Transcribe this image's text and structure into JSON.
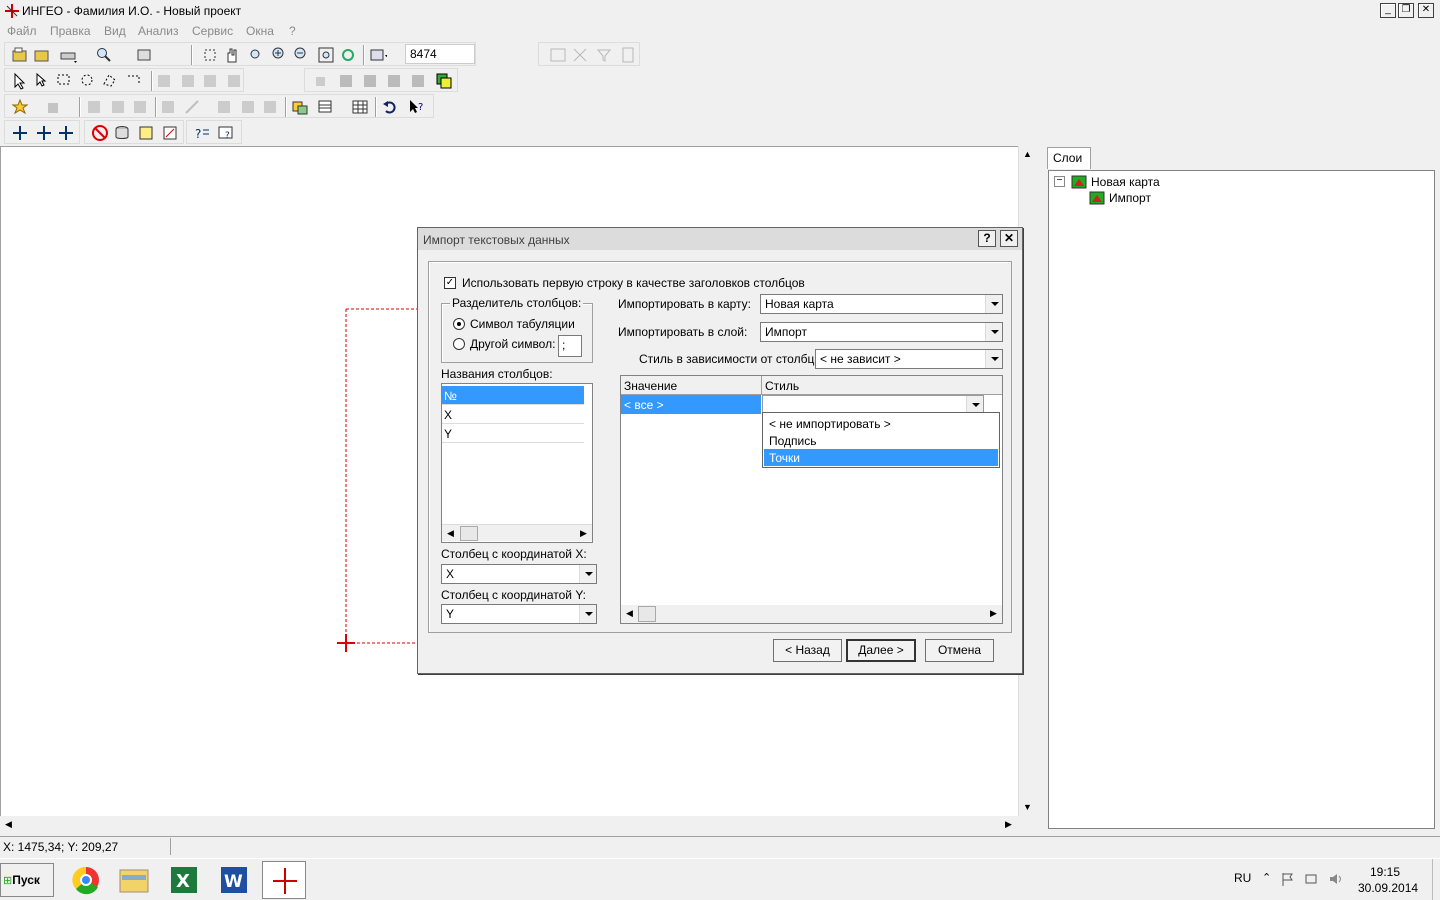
{
  "window": {
    "title": "ИНГЕО - Фамилия И.О. - Новый проект"
  },
  "menu": [
    "Файл",
    "Правка",
    "Вид",
    "Анализ",
    "Сервис",
    "Окна",
    "?"
  ],
  "toolbar": {
    "scale_value": "8474"
  },
  "layers_panel": {
    "tab": "Слои",
    "tree": [
      {
        "label": "Новая карта",
        "level": 0
      },
      {
        "label": "Импорт",
        "level": 1
      }
    ]
  },
  "status": {
    "coords": "X: 1475,34; Y: 209,27"
  },
  "taskbar": {
    "start": "Пуск",
    "lang": "RU",
    "time": "19:15",
    "date": "30.09.2014"
  },
  "dialog": {
    "title": "Импорт текстовых данных",
    "help": "?",
    "first_row_header": "Использовать первую строку в качестве заголовков столбцов",
    "separator_group": "Разделитель столбцов:",
    "sep_tab": "Символ табуляции",
    "sep_other": "Другой символ:",
    "sep_char": ";",
    "columns_label": "Названия столбцов:",
    "columns": [
      "№",
      "X",
      "Y"
    ],
    "x_col_label": "Столбец с координатой X:",
    "x_col_value": "X",
    "y_col_label": "Столбец с координатой Y:",
    "y_col_value": "Y",
    "import_map_label": "Импортировать в карту:",
    "import_map_value": "Новая карта",
    "import_layer_label": "Импортировать в слой:",
    "import_layer_value": "Импорт",
    "style_col_label": "Стиль в зависимости от столбца:",
    "style_col_value": "< не зависит >",
    "grid_headers": [
      "Значение",
      "Стиль"
    ],
    "grid_row_value": "< все >",
    "style_options": [
      "< не импортировать >",
      "Подпись",
      "Точки"
    ],
    "style_selected": "Точки",
    "buttons": {
      "back": "< Назад",
      "next": "Далее >",
      "cancel": "Отмена"
    }
  },
  "colors": {
    "selection": "#3399ff",
    "map_marker": "#e00000"
  }
}
